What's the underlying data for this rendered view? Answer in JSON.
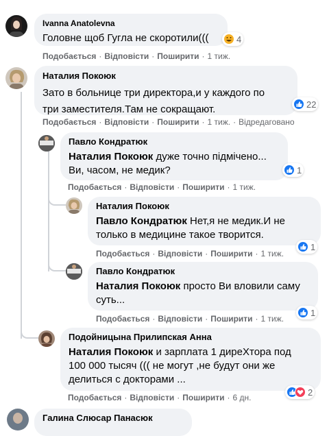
{
  "comments": [
    {
      "author": "Ivanna Anatolevna",
      "text": "Головне щоб Гугла не скоротили(((",
      "reactions": {
        "icons": [
          "haha-icon"
        ],
        "count": "4"
      },
      "actions": {
        "like": "Подобається",
        "reply": "Відповісти",
        "share": "Поширити",
        "time": "1 тиж."
      }
    },
    {
      "author": "Наталия Покоюк",
      "text": "Зато в больнице три директора,и у каждого по три заместителя.Там не сокращают.",
      "reactions": {
        "icons": [
          "like-icon"
        ],
        "count": "22"
      },
      "actions": {
        "like": "Подобається",
        "reply": "Відповісти",
        "share": "Поширити",
        "time": "1 тиж.",
        "edited": "Відредаговано"
      }
    },
    {
      "author": "Павло Кондратюк",
      "mention": "Наталия Покоюк",
      "text": " дуже точно підмічено... Ви, часом, не медик?",
      "reactions": {
        "icons": [
          "like-icon"
        ],
        "count": "1"
      },
      "actions": {
        "like": "Подобається",
        "reply": "Відповісти",
        "share": "Поширити",
        "time": "1 тиж."
      }
    },
    {
      "author": "Наталия Покоюк",
      "mention": "Павло Кондратюк",
      "text": " Нет,я не медик.И не только в медицине такое творится.",
      "reactions": {
        "icons": [
          "like-icon"
        ],
        "count": "1"
      },
      "actions": {
        "like": "Подобається",
        "reply": "Відповісти",
        "share": "Поширити",
        "time": "1 тиж."
      }
    },
    {
      "author": "Павло Кондратюк",
      "mention": "Наталия Покоюк",
      "text": " просто Ви вловили саму суть...",
      "reactions": {
        "icons": [
          "like-icon"
        ],
        "count": "1"
      },
      "actions": {
        "like": "Подобається",
        "reply": "Відповісти",
        "share": "Поширити",
        "time": "1 тиж."
      }
    },
    {
      "author": "Подойницына Прилипская Анна",
      "mention": "Наталия Покоюк",
      "text": " и зарплата 1 диреХтора под 100 000 тысяч ((( не могут ,не будут они же делиться с докторами ...",
      "reactions": {
        "icons": [
          "like-icon",
          "love-icon"
        ],
        "count": "2"
      },
      "actions": {
        "like": "Подобається",
        "reply": "Відповісти",
        "share": "Поширити",
        "time": "6 дн."
      }
    },
    {
      "author": "Галина Слюсар Панасюк"
    }
  ],
  "colors": {
    "bubble": "#f0f2f5",
    "meta": "#65676b",
    "like": "#1877f2",
    "love": "#f33e58",
    "haha": "#f7b125"
  }
}
